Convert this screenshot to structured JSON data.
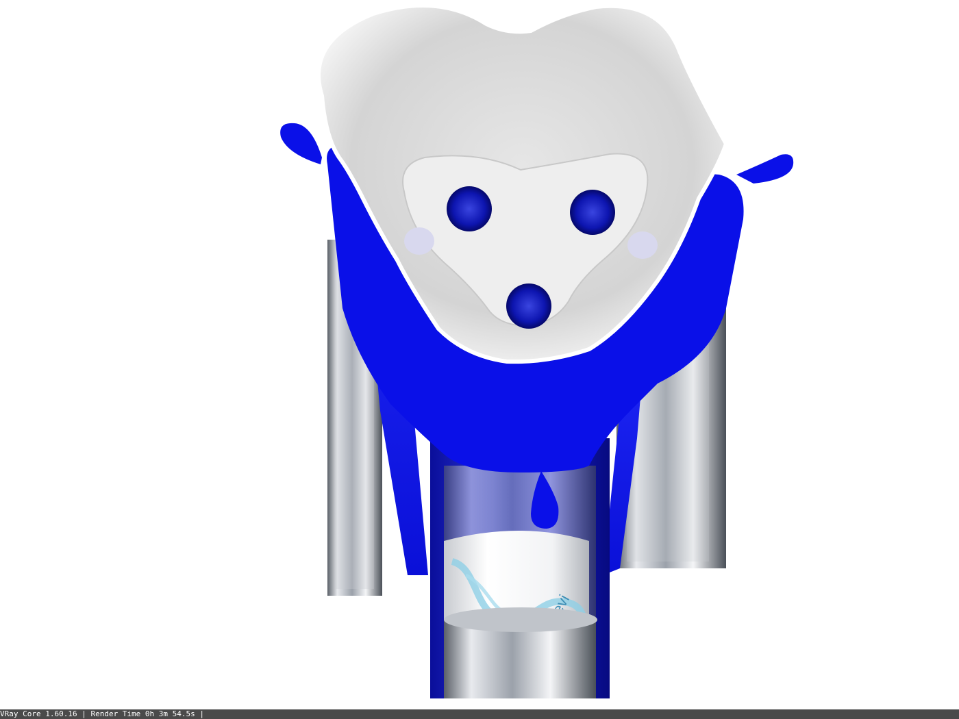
{
  "render": {
    "subject": "product-render",
    "colors": {
      "brand_blue": "#0a10e8",
      "tray_white": "#efefef",
      "tube_steel": "#9aa0a8",
      "label_water": "#8fd0e6",
      "background": "#ffffff",
      "status_bg": "#4a4a4a"
    },
    "label_logo_text": "revi"
  },
  "status_bar": {
    "text": "VRay Core 1.60.16 | Render Time 0h 3m 54.5s |"
  }
}
